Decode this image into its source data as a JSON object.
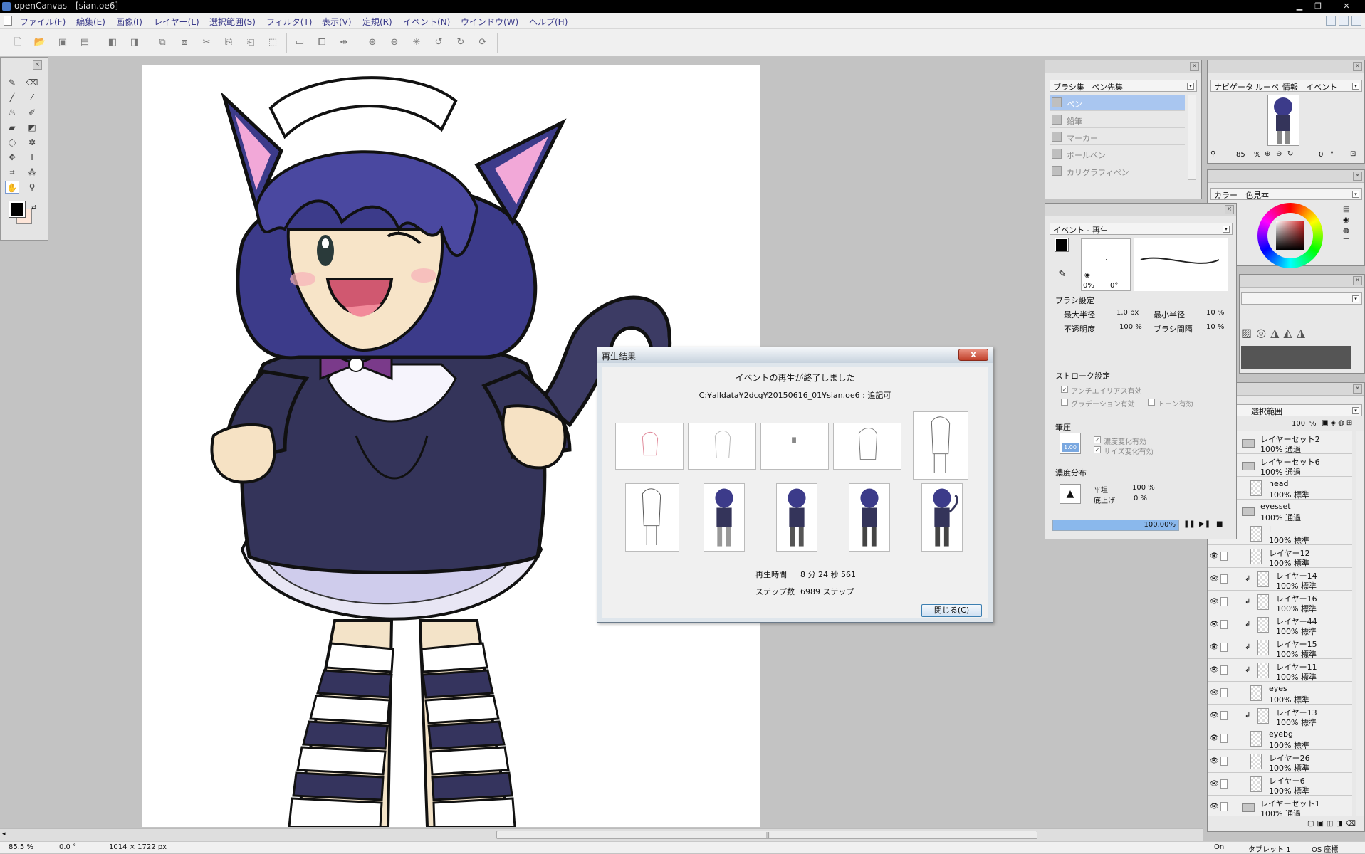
{
  "window": {
    "title": "openCanvas - [sian.oe6]"
  },
  "menu": [
    "ファイル(F)",
    "編集(E)",
    "画像(I)",
    "レイヤー(L)",
    "選択範囲(S)",
    "フィルタ(T)",
    "表示(V)",
    "定規(R)",
    "イベント(N)",
    "ウインドウ(W)",
    "ヘルプ(H)"
  ],
  "brush_panel": {
    "tabs": [
      "ブラシ集",
      "ペン先集"
    ],
    "items": [
      "ペン",
      "鉛筆",
      "マーカー",
      "ボールペン",
      "カリグラフィペン"
    ],
    "selected": "ペン"
  },
  "navigator_panel": {
    "tabs": [
      "ナビゲータ",
      "ルーペ",
      "情報",
      "イベント"
    ],
    "zoom_value": "85",
    "zoom_unit": "%",
    "rotation_value": "0",
    "rotation_unit": "°"
  },
  "color_panel": {
    "tabs": [
      "カラー",
      "色見本"
    ],
    "primary_color": "#000000",
    "secondary_color": "#fde5d8"
  },
  "event_panel": {
    "tab": "イベント - 再生",
    "brush_preview_size": "0%",
    "brush_preview_angle": "0°",
    "brush_settings_title": "ブラシ設定",
    "max_radius_label": "最大半径",
    "max_radius_value": "1.0 px",
    "min_radius_label": "最小半径",
    "min_radius_value": "10 %",
    "opacity_label": "不透明度",
    "opacity_value": "100 %",
    "interval_label": "ブラシ間隔",
    "interval_value": "10 %",
    "stroke_title": "ストローク設定",
    "antialias_label": "アンチエイリアス有効",
    "gradation_label": "グラデーション有効",
    "tone_label": "トーン有効",
    "pressure_title": "筆圧",
    "pressure_value": "1.00",
    "density_change_label": "濃度変化有効",
    "size_change_label": "サイズ変化有効",
    "density_dist_title": "濃度分布",
    "flat_label": "平坦",
    "flat_value": "100 %",
    "raise_label": "底上げ",
    "raise_value": "0 %",
    "progress_text": "100.00%",
    "progress": 1.0
  },
  "layer_panel": {
    "tab": "選択範囲",
    "opacity_value": "100",
    "opacity_unit": "%",
    "layers": [
      {
        "name": "レイヤーセット2",
        "mode": "100% 通過",
        "type": "folder",
        "visible": false,
        "clip": false
      },
      {
        "name": "レイヤーセット6",
        "mode": "100% 通過",
        "type": "folder",
        "visible": false,
        "clip": false
      },
      {
        "name": "head",
        "mode": "100% 標準",
        "type": "layer",
        "visible": false,
        "clip": false
      },
      {
        "name": "eyesset",
        "mode": "100% 通過",
        "type": "folder",
        "visible": false,
        "clip": false
      },
      {
        "name": "l",
        "mode": "100% 標準",
        "type": "layer",
        "visible": false,
        "clip": false
      },
      {
        "name": "レイヤー12",
        "mode": "100% 標準",
        "type": "layer",
        "visible": true,
        "clip": false
      },
      {
        "name": "レイヤー14",
        "mode": "100% 標準",
        "type": "layer",
        "visible": true,
        "clip": true
      },
      {
        "name": "レイヤー16",
        "mode": "100% 標準",
        "type": "layer",
        "visible": true,
        "clip": true
      },
      {
        "name": "レイヤー44",
        "mode": "100% 標準",
        "type": "layer",
        "visible": true,
        "clip": true
      },
      {
        "name": "レイヤー15",
        "mode": "100% 標準",
        "type": "layer",
        "visible": true,
        "clip": true
      },
      {
        "name": "レイヤー11",
        "mode": "100% 標準",
        "type": "layer",
        "visible": true,
        "clip": true
      },
      {
        "name": "eyes",
        "mode": "100% 標準",
        "type": "layer",
        "visible": true,
        "clip": false
      },
      {
        "name": "レイヤー13",
        "mode": "100% 標準",
        "type": "layer",
        "visible": true,
        "clip": true
      },
      {
        "name": "eyebg",
        "mode": "100% 標準",
        "type": "layer",
        "visible": true,
        "clip": false
      },
      {
        "name": "レイヤー26",
        "mode": "100% 標準",
        "type": "layer",
        "visible": true,
        "clip": false
      },
      {
        "name": "レイヤー6",
        "mode": "100% 標準",
        "type": "layer",
        "visible": true,
        "clip": false
      },
      {
        "name": "レイヤーセット1",
        "mode": "100% 通過",
        "type": "folder",
        "visible": true,
        "clip": false
      }
    ]
  },
  "dialog": {
    "title": "再生結果",
    "close_x": "x",
    "message": "イベントの再生が終了しました",
    "path": "C:¥alldata¥2dcg¥20150616_01¥sian.oe6 : 追記可",
    "time_label": "再生時間",
    "time_value": "8 分 24 秒 561",
    "steps_label": "ステップ数",
    "steps_value": "6989 ステップ",
    "close_button": "閉じる(C)"
  },
  "status": {
    "zoom": "85.5 %",
    "angle": "0.0 °",
    "size": "1014 × 1722 px",
    "on": "On",
    "tablet": "タブレット 1",
    "os": "OS 座標"
  },
  "colors": {
    "hair": "#3c3b8a",
    "outfit": "#34345a",
    "skin": "#f7e4c8",
    "ribbon": "#7a3a8a"
  }
}
